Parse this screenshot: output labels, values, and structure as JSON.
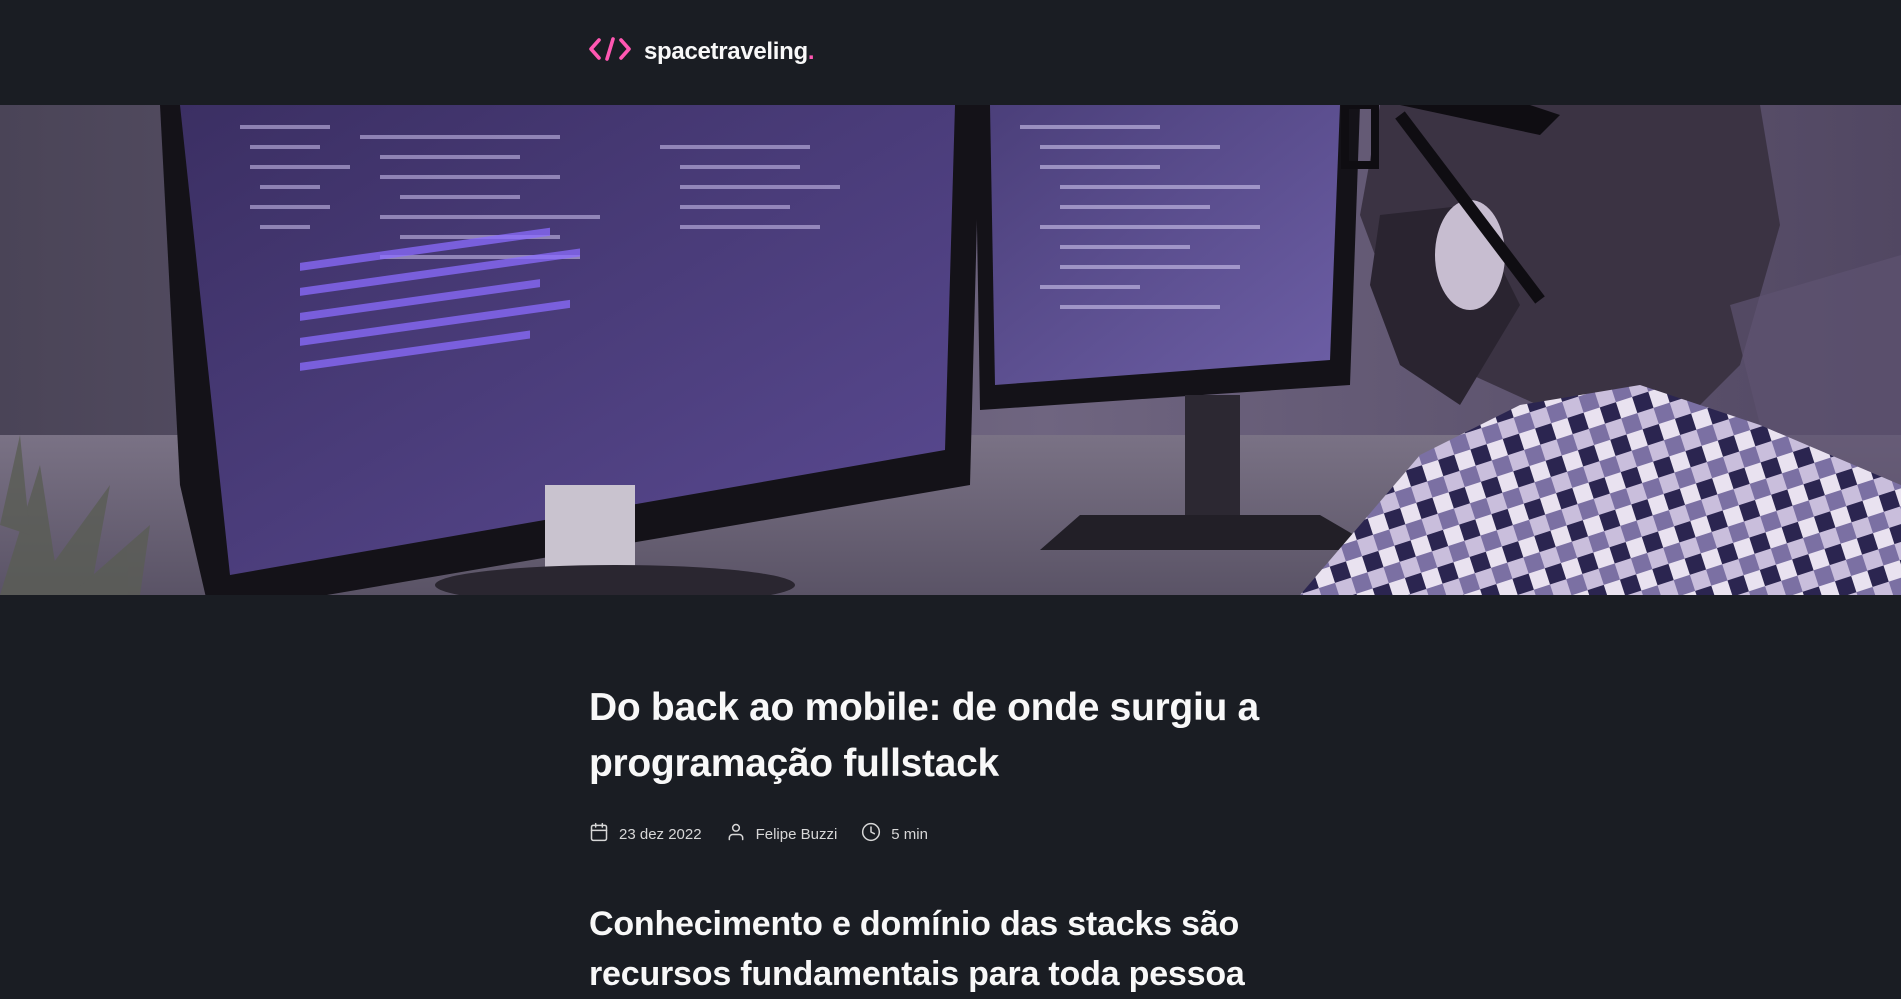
{
  "header": {
    "logo_text": "spacetraveling",
    "logo_dot": "."
  },
  "banner": {
    "icon": "post-banner-image"
  },
  "post": {
    "title": "Do back ao mobile: de onde surgiu a programação fullstack",
    "date": "23 dez 2022",
    "author": "Felipe Buzzi",
    "reading_time": "5 min",
    "first_heading": "Conhecimento e domínio das stacks são recursos fundamentais para toda pessoa"
  },
  "colors": {
    "background": "#1a1d23",
    "accent": "#ff57b2",
    "text": "#f8f8f8",
    "muted": "#d7d7d7"
  },
  "icons": {
    "logo": "code-brackets-icon",
    "date": "calendar-icon",
    "author": "user-icon",
    "reading_time": "clock-icon"
  }
}
